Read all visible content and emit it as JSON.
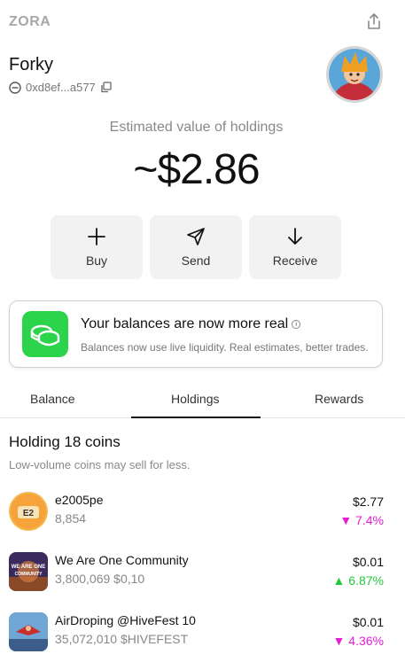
{
  "app": {
    "brand": "ZORA"
  },
  "profile": {
    "name": "Forky",
    "address": "0xd8ef...a577"
  },
  "holdings_summary": {
    "label": "Estimated value of holdings",
    "value": "~$2.86"
  },
  "actions": [
    {
      "label": "Buy",
      "icon": "plus-icon"
    },
    {
      "label": "Send",
      "icon": "send-icon"
    },
    {
      "label": "Receive",
      "icon": "arrow-down-icon"
    }
  ],
  "banner": {
    "title": "Your balances are now more real",
    "info_glyph": "i",
    "subtitle": "Balances now use live liquidity. Real estimates, better trades.",
    "accent": "#2bd44b"
  },
  "tabs": [
    {
      "label": "Balance",
      "active": false
    },
    {
      "label": "Holdings",
      "active": true
    },
    {
      "label": "Rewards",
      "active": false
    }
  ],
  "holdings": {
    "title": "Holding 18 coins",
    "subtitle": "Low-volume coins may sell for less.",
    "coins": [
      {
        "name": "e2005pe",
        "sub": "8,854",
        "value": "$2.77",
        "change": "7.4%",
        "direction": "down",
        "badge": "E2"
      },
      {
        "name": "We Are One Community",
        "sub": "3,800,069 $0,10",
        "value": "$0.01",
        "change": "6.87%",
        "direction": "up",
        "badge": "WE ARE ONE COMMUNITY"
      },
      {
        "name": "AirDroping @HiveFest 10",
        "sub": "35,072,010 $HIVEFEST",
        "value": "$0.01",
        "change": "4.36%",
        "direction": "down",
        "badge": ""
      }
    ]
  },
  "colors": {
    "down": "#e51dd6",
    "up": "#1fc83e"
  }
}
